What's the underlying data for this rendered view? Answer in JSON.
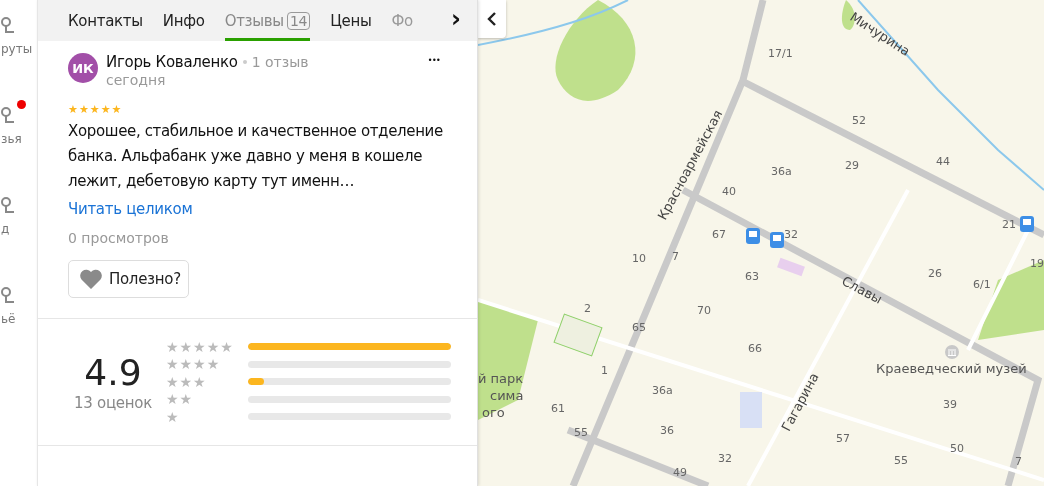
{
  "sidebar": {
    "items": [
      {
        "label": "руты",
        "badge": false
      },
      {
        "label": "зья",
        "badge": true
      },
      {
        "label": "д",
        "badge": false
      },
      {
        "label": "ьё",
        "badge": false
      }
    ]
  },
  "tabs": [
    {
      "label": "Контакты",
      "selected": false
    },
    {
      "label": "Инфо",
      "selected": false
    },
    {
      "label": "Отзывы",
      "selected": true,
      "count": "14"
    },
    {
      "label": "Цены",
      "selected": false
    },
    {
      "label": "Фо",
      "selected": false
    }
  ],
  "tabs_next": "›",
  "review": {
    "initials": "ИК",
    "author": "Игорь Коваленко",
    "author_reviews": "1 отзыв",
    "date": "сегодня",
    "stars": 5,
    "menu": "•••",
    "text": "Хорошее, стабильное и качественное отделение банка. Альфабанк уже давно у меня в кошеле лежит, дебетовую карту тут именн…",
    "read_more": "Читать целиком",
    "views": "0 просмотров",
    "helpful": "Полезно?"
  },
  "rating": {
    "score": "4.9",
    "count": "13 оценок",
    "bars": [
      {
        "label": "★★★★★",
        "level": 1
      },
      {
        "label": "★★★★",
        "level": 0
      },
      {
        "label": "★★★",
        "level": 0.08
      },
      {
        "label": "★★",
        "level": 0
      },
      {
        "label": "★",
        "level": 0
      }
    ]
  },
  "map": {
    "street_labels": [
      "Мичурина",
      "Красноармейская",
      "Славы",
      "Гагарина"
    ],
    "poi_labels": [
      "Краеведческий музей"
    ],
    "park_labels": [
      "й парк",
      "сима",
      "ого"
    ],
    "house_numbers": [
      "17/1",
      "52",
      "29",
      "44",
      "36а",
      "40",
      "67",
      "32",
      "21",
      "10",
      "7",
      "63",
      "26",
      "6/1",
      "19",
      "2",
      "70",
      "65",
      "66",
      "1",
      "36а",
      "61",
      "55",
      "36",
      "32",
      "49",
      "57",
      "55",
      "50",
      "39",
      "7"
    ]
  }
}
